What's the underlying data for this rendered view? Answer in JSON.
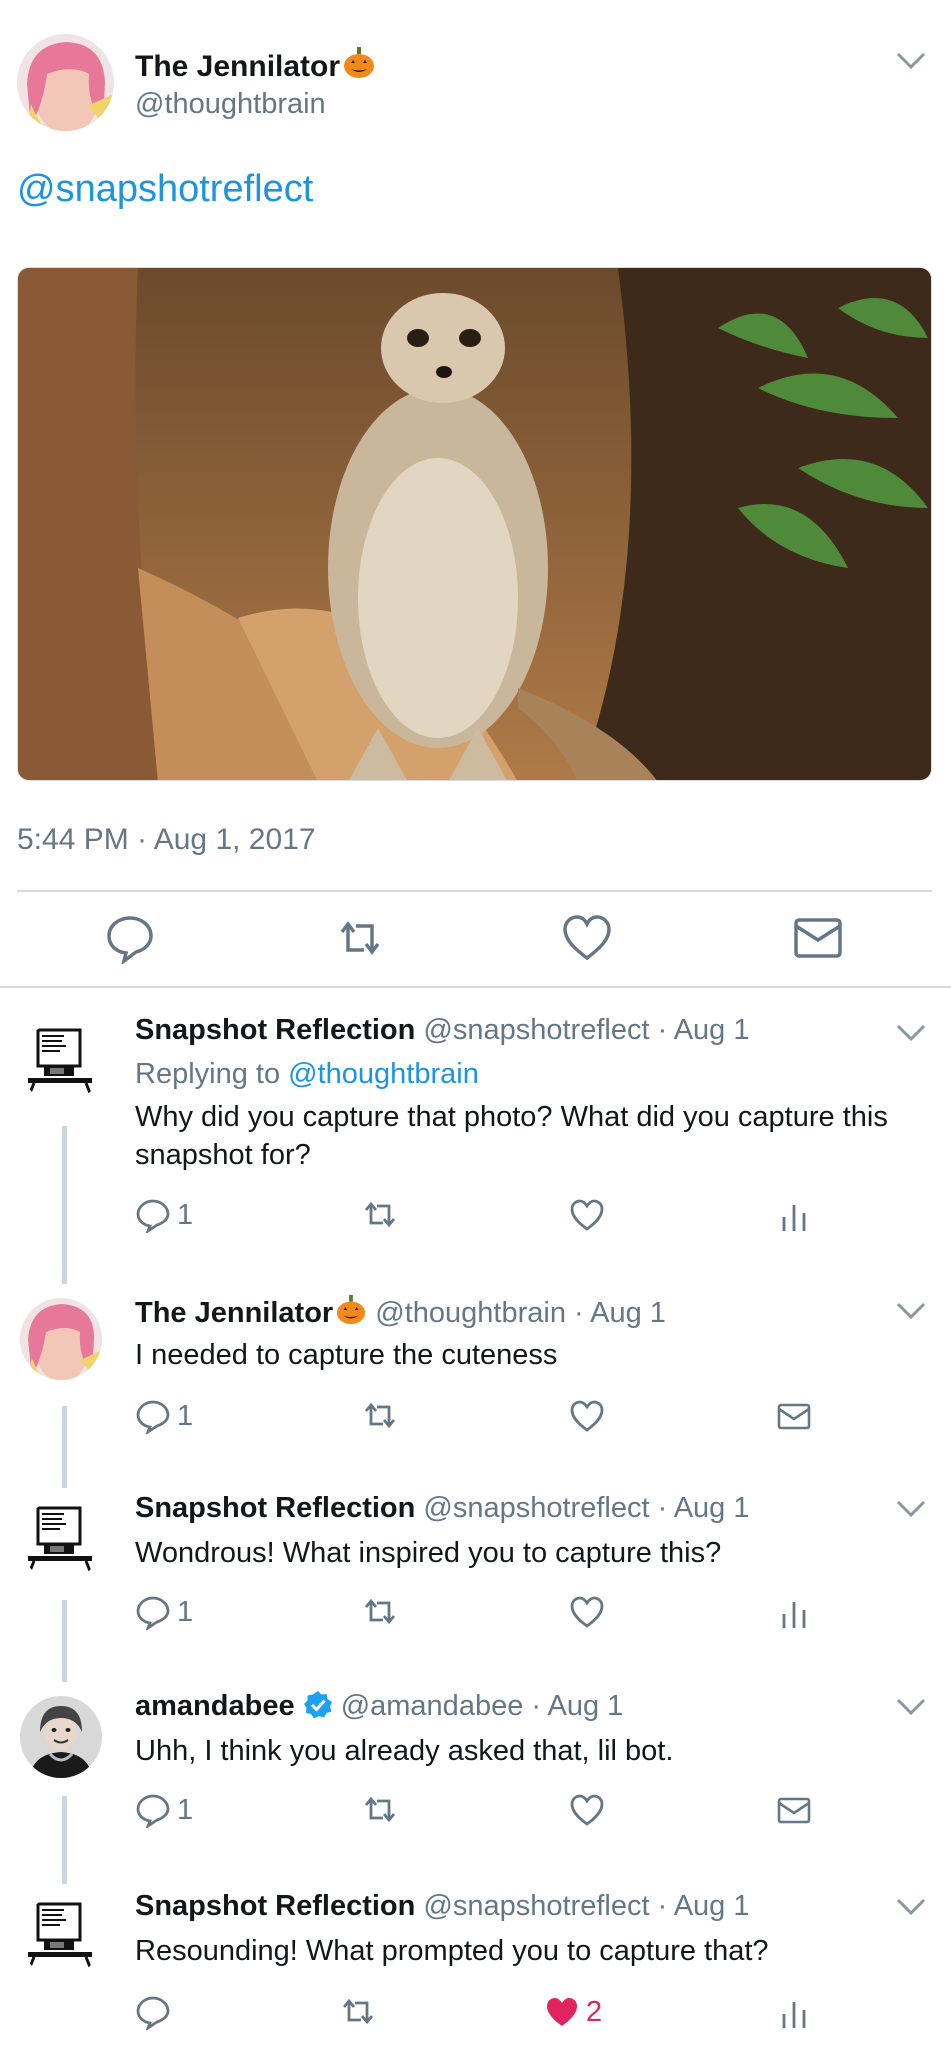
{
  "main_tweet": {
    "author_name": "The Jennilator",
    "author_handle": "@thoughtbrain",
    "text": "@snapshotreflect",
    "timestamp": "5:44 PM · Aug 1, 2017",
    "actions": [
      "reply-icon",
      "retweet-icon",
      "like-icon",
      "dm-icon"
    ]
  },
  "replies": [
    {
      "name": "Snapshot Reflection",
      "handle": "@snapshotreflect",
      "date": "· Aug 1",
      "replying_prefix": "Replying to",
      "replying_to": "@thoughtbrain",
      "text": "Why did you capture that photo? What did you capture this snapshot for?",
      "reply_count": "1",
      "like_count": "",
      "last_icon": "analytics-icon"
    },
    {
      "name": "The Jennilator",
      "handle": "@thoughtbrain",
      "date": "· Aug 1",
      "text": "I needed to capture the cuteness",
      "reply_count": "1",
      "like_count": "",
      "last_icon": "dm-icon"
    },
    {
      "name": "Snapshot Reflection",
      "handle": "@snapshotreflect",
      "date": "· Aug 1",
      "text": "Wondrous! What inspired you to capture this?",
      "reply_count": "1",
      "like_count": "",
      "last_icon": "analytics-icon"
    },
    {
      "name": "amandabee",
      "handle": "@amandabee",
      "date": "· Aug 1",
      "verified": true,
      "text": "Uhh, I think you already asked that, lil bot.",
      "reply_count": "1",
      "like_count": "",
      "last_icon": "dm-icon"
    },
    {
      "name": "Snapshot Reflection",
      "handle": "@snapshotreflect",
      "date": "· Aug 1",
      "text": "Resounding! What prompted you to capture that?",
      "reply_count": "",
      "like_count": "2",
      "liked": true,
      "last_icon": "analytics-icon"
    }
  ],
  "colors": {
    "link": "#1b95e0",
    "secondary_text": "#657786",
    "divider": "#d5dde4",
    "liked": "#e0245e",
    "verified": "#1da1f2"
  }
}
